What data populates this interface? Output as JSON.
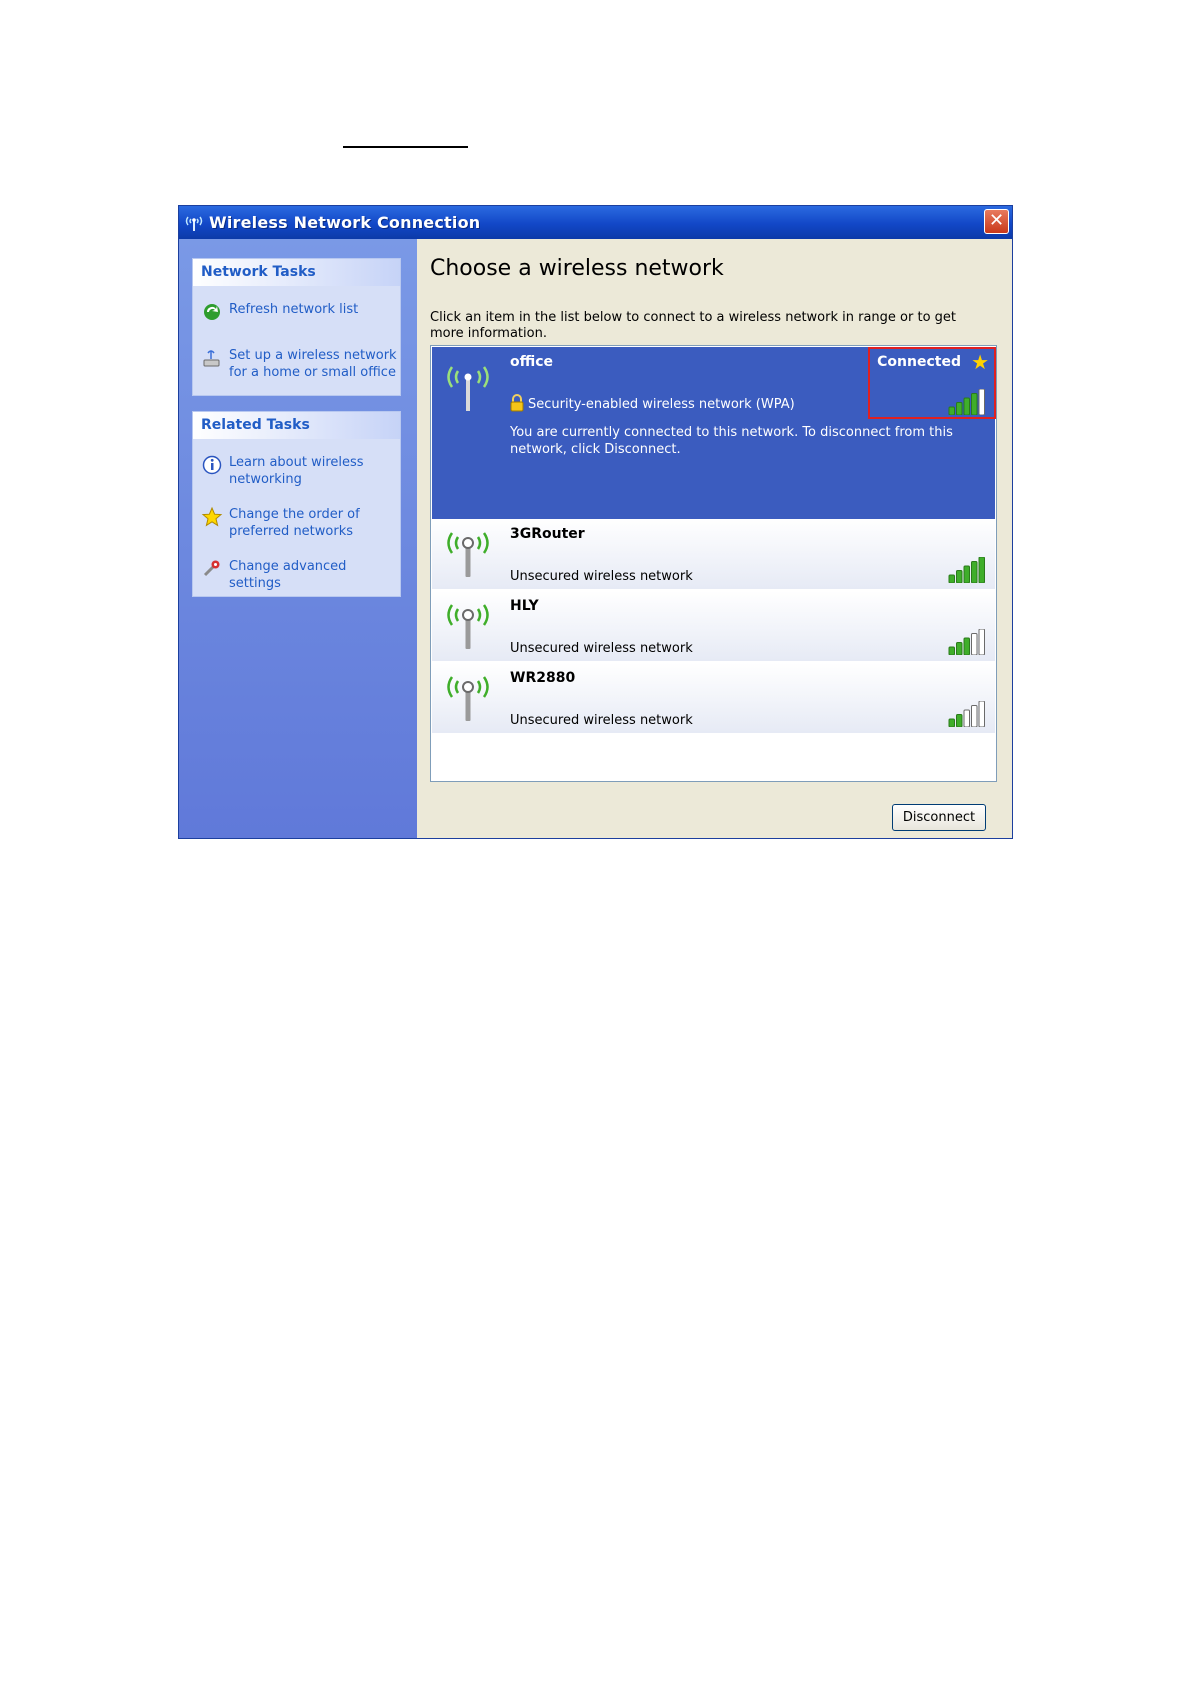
{
  "window": {
    "title": "Wireless Network Connection",
    "close_glyph": "✕"
  },
  "sidebar": {
    "network_tasks": {
      "header": "Network Tasks",
      "items": [
        {
          "label": "Refresh network list",
          "icon": "refresh-icon"
        },
        {
          "label": "Set up a wireless network for a home or small office",
          "icon": "setup-network-icon"
        }
      ]
    },
    "related_tasks": {
      "header": "Related Tasks",
      "items": [
        {
          "label": "Learn about wireless networking",
          "icon": "info-icon"
        },
        {
          "label": "Change the order of preferred networks",
          "icon": "star-icon"
        },
        {
          "label": "Change advanced settings",
          "icon": "settings-icon"
        }
      ]
    }
  },
  "main": {
    "heading": "Choose a wireless network",
    "intro": "Click an item in the list below to connect to a wireless network in range or to get more information.",
    "networks": [
      {
        "name": "office",
        "security": "Security-enabled wireless network (WPA)",
        "status": "Connected",
        "detail": "You are currently connected to this network. To disconnect from this network, click Disconnect.",
        "signal_bars": 4,
        "selected": true
      },
      {
        "name": "3GRouter",
        "security": "Unsecured wireless network",
        "signal_bars": 5
      },
      {
        "name": "HLY",
        "security": "Unsecured wireless network",
        "signal_bars": 3
      },
      {
        "name": "WR2880",
        "security": "Unsecured wireless network",
        "signal_bars": 2
      }
    ],
    "disconnect_label": "Disconnect"
  },
  "colors": {
    "title_bar": "#1247c7",
    "sidebar": "#6a88df",
    "selected_row": "#3b5cbf",
    "link": "#215dc6",
    "signal_on": "#3fae2a",
    "highlight": "#e02020"
  }
}
